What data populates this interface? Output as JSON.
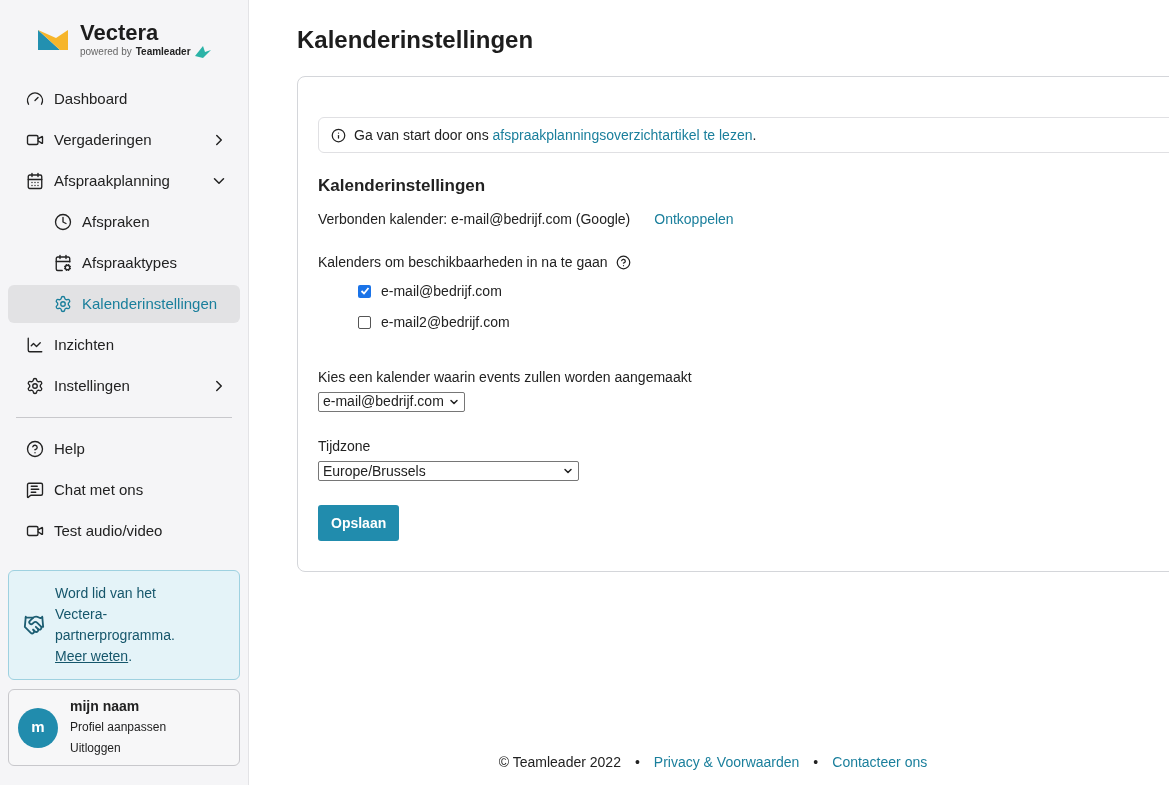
{
  "logo": {
    "name": "Vectera",
    "powered_by": "powered by",
    "brand": "Teamleader"
  },
  "nav": [
    {
      "label": "Dashboard",
      "selected": false
    },
    {
      "label": "Vergaderingen",
      "selected": false,
      "expanded": false
    },
    {
      "label": "Afspraakplanning",
      "selected": false,
      "expanded": true,
      "children": [
        {
          "label": "Afspraken",
          "selected": false
        },
        {
          "label": "Afspraaktypes",
          "selected": false
        },
        {
          "label": "Kalenderinstellingen",
          "selected": true
        }
      ]
    },
    {
      "label": "Inzichten",
      "selected": false
    },
    {
      "label": "Instellingen",
      "selected": false,
      "expanded": false
    }
  ],
  "nav_secondary": [
    {
      "label": "Help"
    },
    {
      "label": "Chat met ons"
    },
    {
      "label": "Test audio/video"
    }
  ],
  "partner": {
    "text": "Word lid van het Vectera-partnerprogramma.",
    "link": "Meer weten",
    "after": "."
  },
  "profile": {
    "initial": "m",
    "name": "mijn naam",
    "edit": "Profiel aanpassen",
    "logout": "Uitloggen"
  },
  "page_title": "Kalenderinstellingen",
  "info": {
    "text": "Ga van start door ons ",
    "link": "afspraakplanningsoverzichtartikel te lezen",
    "after": "."
  },
  "section_title": "Kalenderinstellingen",
  "connected": {
    "text": "Verbonden kalender: e-mail@bedrijf.com (Google)",
    "action": "Ontkoppelen"
  },
  "availability": {
    "label": "Kalenders om beschikbaarheden in na te gaan",
    "calendars": [
      {
        "label": "e-mail@bedrijf.com",
        "checked": true
      },
      {
        "label": "e-mail2@bedrijf.com",
        "checked": false
      }
    ]
  },
  "create_calendar": {
    "label": "Kies een kalender waarin events zullen worden aangemaakt",
    "value": "e-mail@bedrijf.com"
  },
  "timezone": {
    "label": "Tijdzone",
    "value": "Europe/Brussels"
  },
  "save_button": "Opslaan",
  "footer": [
    {
      "kind": "text",
      "text": "© Teamleader 2022"
    },
    {
      "kind": "separator",
      "text": "•"
    },
    {
      "kind": "link",
      "text": "Privacy & Voorwaarden"
    },
    {
      "kind": "separator",
      "text": "•"
    },
    {
      "kind": "link",
      "text": "Contacteer ons"
    }
  ]
}
